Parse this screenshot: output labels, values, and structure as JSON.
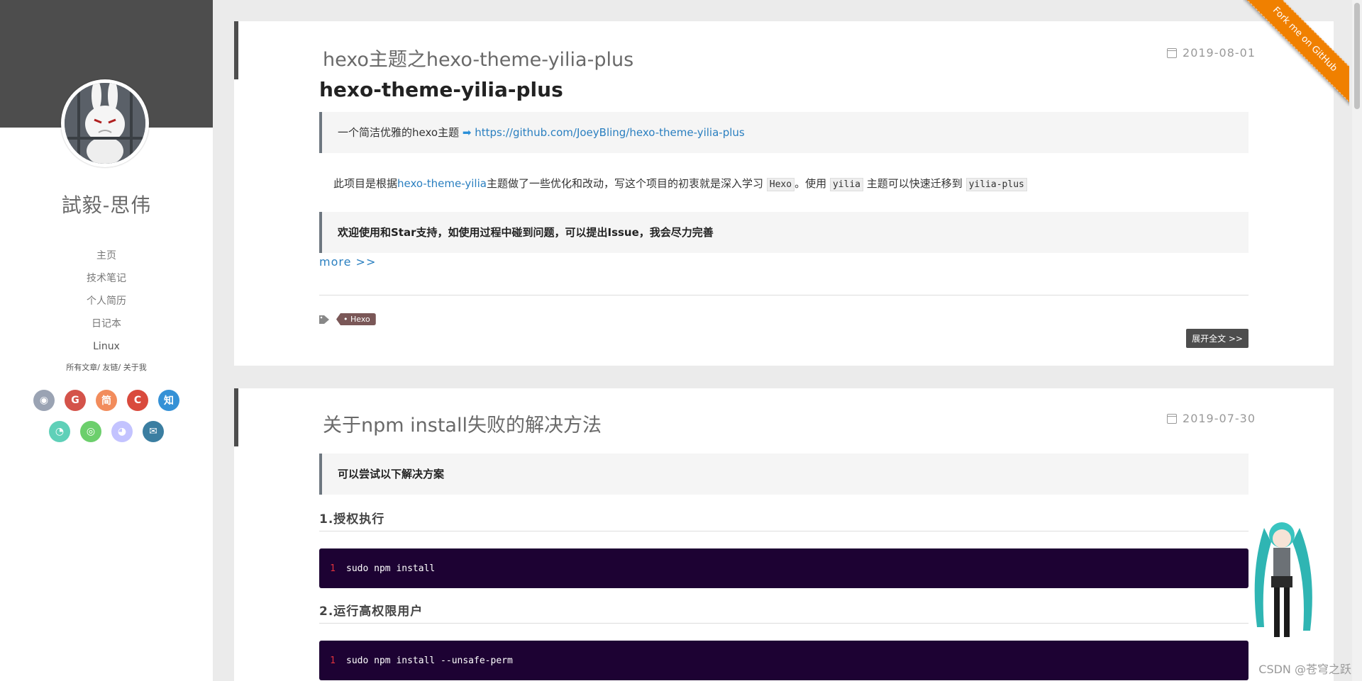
{
  "sidebar": {
    "site_name": "試毅-思伟",
    "nav": [
      "主页",
      "技术笔记",
      "个人简历",
      "日记本",
      "Linux"
    ],
    "subnav": [
      "所有文章",
      "友链",
      "关于我"
    ],
    "social_row1": [
      {
        "icon": "github-icon",
        "color": "#9aa3b3",
        "glyph": "◉"
      },
      {
        "icon": "google-icon",
        "color": "#d4534a",
        "glyph": "G"
      },
      {
        "icon": "jianshu-icon",
        "color": "#f28c5c",
        "glyph": "简"
      },
      {
        "icon": "csdn-icon",
        "color": "#d94a3d",
        "glyph": "C"
      },
      {
        "icon": "zhihu-icon",
        "color": "#3591d6",
        "glyph": "知"
      }
    ],
    "social_row2": [
      {
        "icon": "qq-icon",
        "color": "#5fd0b8",
        "glyph": "◔"
      },
      {
        "icon": "wechat-icon",
        "color": "#6ccf6c",
        "glyph": "◎"
      },
      {
        "icon": "weibo-icon",
        "color": "#c3c3ff",
        "glyph": "◕"
      },
      {
        "icon": "email-icon",
        "color": "#3b7ea1",
        "glyph": "✉"
      }
    ]
  },
  "ribbon": "Fork me on GitHub",
  "post1": {
    "title": "hexo主题之hexo-theme-yilia-plus",
    "date": "2019-08-01",
    "heading": "hexo-theme-yilia-plus",
    "quote_text": "一个简洁优雅的hexo主题",
    "quote_arrow": "➡",
    "quote_link": "https://github.com/JoeyBling/hexo-theme-yilia-plus",
    "para_part1": "此项目是根据",
    "para_link": "hexo-theme-yilia",
    "para_part2": "主题做了一些优化和改动，写这个项目的初衷就是深入学习",
    "code1": "Hexo",
    "para_part3": "。使用",
    "code2": "yilia",
    "para_part4": "主题可以快速迁移到",
    "code3": "yilia-plus",
    "quote2": "欢迎使用和Star支持，如使用过程中碰到问题，可以提出Issue，我会尽力完善",
    "more": "more >>",
    "tag": "Hexo",
    "expand": "展开全文 >>"
  },
  "post2": {
    "title": "关于npm install失败的解决方法",
    "date": "2019-07-30",
    "quote": "可以尝试以下解决方案",
    "h1": "1.授权执行",
    "code1_ln": "1",
    "code1": "sudo npm install",
    "h2": "2.运行高权限用户",
    "code2_ln": "1",
    "code2": "sudo npm install --unsafe-perm"
  },
  "watermark": "CSDN @苍穹之跃"
}
